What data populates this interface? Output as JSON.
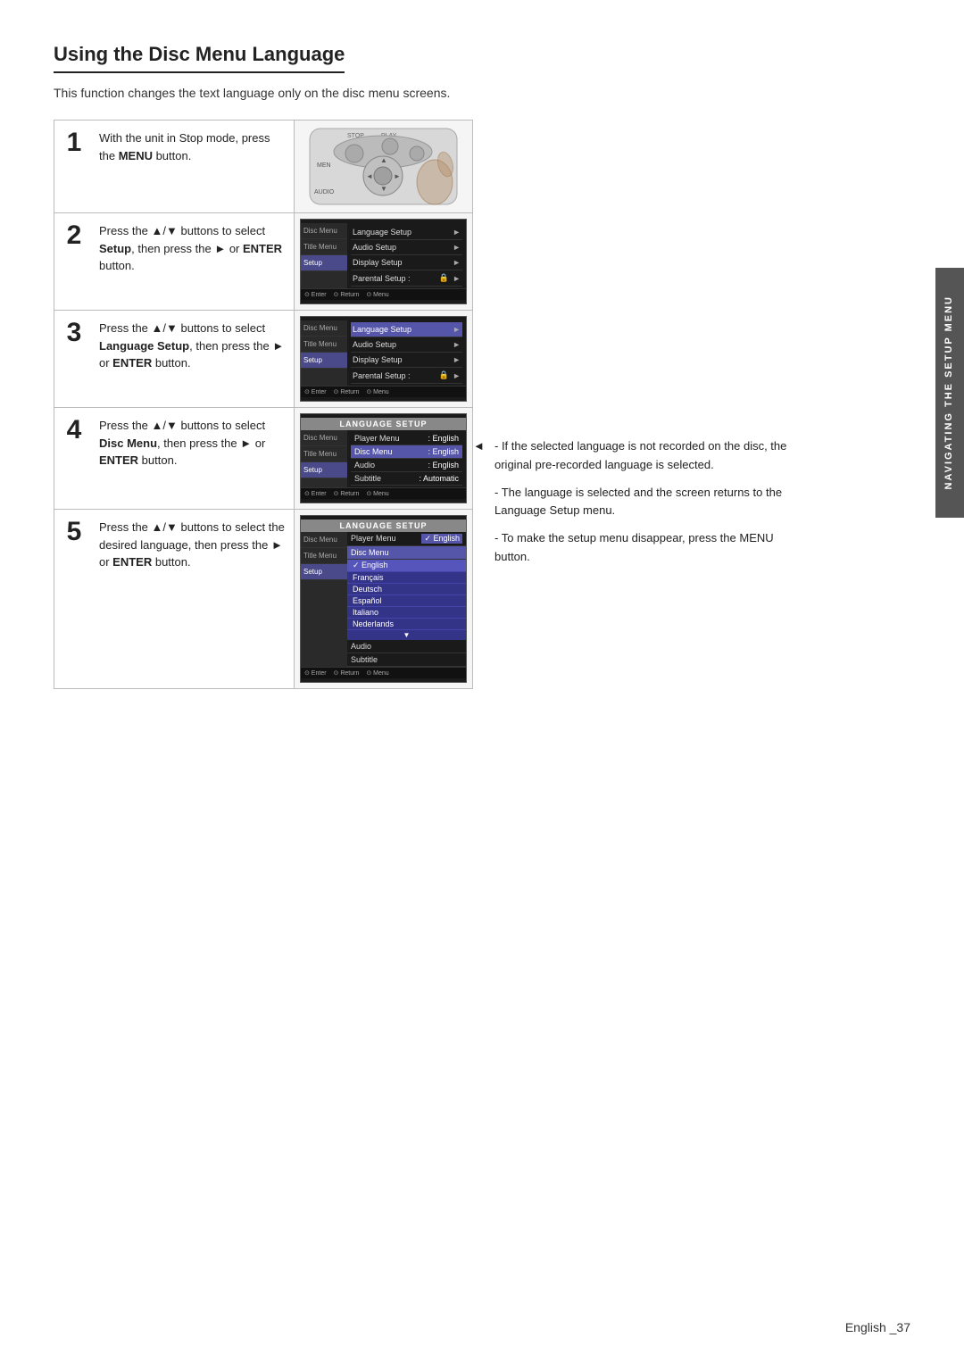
{
  "title": "Using the Disc Menu Language",
  "intro": "This function changes the text language only on the disc menu screens.",
  "steps": [
    {
      "number": "1",
      "text_html": "With the unit in Stop mode, press the <b>MENU</b> button.",
      "image_type": "remote"
    },
    {
      "number": "2",
      "text_html": "Press the ▲/▼ buttons to select <b>Setup</b>, then press the ► or <b>ENTER</b> button.",
      "image_type": "menu_setup"
    },
    {
      "number": "3",
      "text_html": "Press the ▲/▼ buttons to select <b>Language Setup</b>, then press the ► or <b>ENTER</b> button.",
      "image_type": "menu_language"
    },
    {
      "number": "4",
      "text_html": "Press the ▲/▼ buttons to select <b>Disc Menu</b>, then press the ► or <b>ENTER</b> button.",
      "image_type": "lang_discmenu"
    },
    {
      "number": "5",
      "text_html": "Press the ▲/▼ buttons to select the desired language, then press the ► or <b>ENTER</b> button.",
      "image_type": "lang_select"
    }
  ],
  "notes": [
    {
      "bullet": "◄",
      "text": "- If the selected language is not recorded on the disc, the original pre-recorded language is selected."
    },
    {
      "bullet": "",
      "text": "- The language is selected and the screen returns to the Language Setup menu."
    },
    {
      "bullet": "",
      "text": "- To make the setup menu disappear, press the MENU button."
    }
  ],
  "side_tab": "NAVIGATING THE SETUP MENU",
  "footer": "English _37",
  "menu_items": {
    "setup_menu": [
      {
        "label": "Language Setup",
        "value": "",
        "arrow": "►",
        "highlighted": false
      },
      {
        "label": "Audio Setup",
        "value": "",
        "arrow": "►",
        "highlighted": false
      },
      {
        "label": "Display Setup",
        "value": "",
        "arrow": "►",
        "highlighted": false
      },
      {
        "label": "Parental Setup :",
        "value": "🔒",
        "arrow": "►",
        "highlighted": false
      }
    ],
    "sidebar": [
      {
        "label": "Disc Menu",
        "active": false
      },
      {
        "label": "Title Menu",
        "active": false
      },
      {
        "label": "Setup",
        "active": true
      }
    ],
    "language_setup": [
      {
        "label": "Player Menu",
        "value": "English",
        "highlighted": false
      },
      {
        "label": "Disc Menu",
        "value": "English",
        "highlighted": true
      },
      {
        "label": "Audio",
        "value": "English",
        "highlighted": false
      },
      {
        "label": "Subtitle",
        "value": "Automatic",
        "highlighted": false
      }
    ],
    "language_options": [
      "English",
      "Français",
      "Deutsch",
      "Español",
      "Italiano",
      "Nederlands"
    ]
  }
}
